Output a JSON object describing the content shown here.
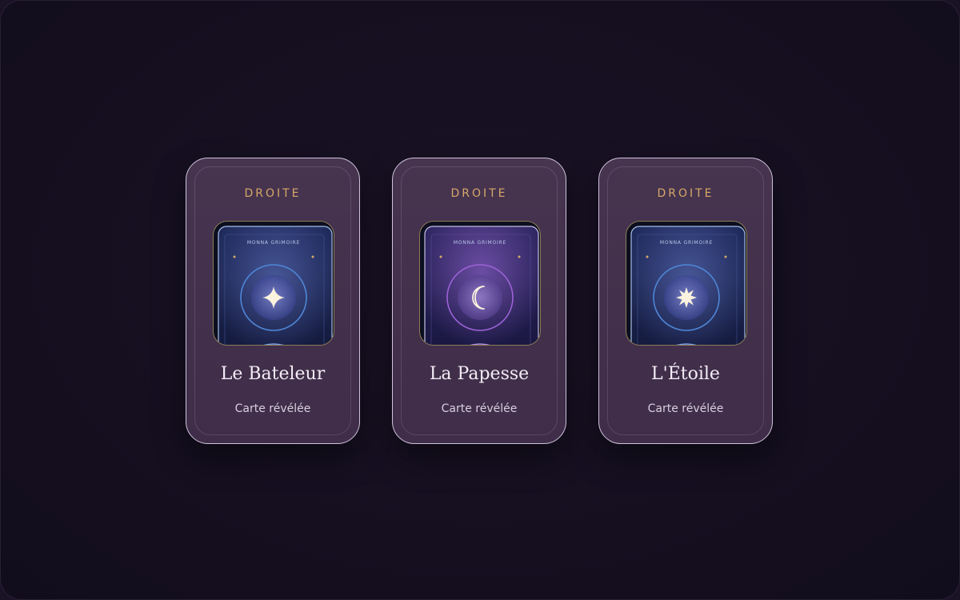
{
  "cards": [
    {
      "position": "DROITE",
      "name": "Le Bateleur",
      "status": "Carte révélée",
      "brand": "MONNA GRIMOIRE",
      "symbol": "four-point-star-icon",
      "accent": "#4f86d6",
      "glow": "#6b7fd0"
    },
    {
      "position": "DROITE",
      "name": "La Papesse",
      "status": "Carte révélée",
      "brand": "MONNA GRIMOIRE",
      "symbol": "crescent-moon-icon",
      "accent": "#9b62d6",
      "glow": "#8a5fc8"
    },
    {
      "position": "DROITE",
      "name": "L'Étoile",
      "status": "Carte révélée",
      "brand": "MONNA GRIMOIRE",
      "symbol": "eight-point-star-icon",
      "accent": "#4f86d6",
      "glow": "#6b7fd0"
    }
  ],
  "colors": {
    "background": "#150f20",
    "card_fill": "#43314c",
    "card_border": "#cfc3dc",
    "position_label": "#d5a869",
    "name_text": "#f3ecf5"
  }
}
